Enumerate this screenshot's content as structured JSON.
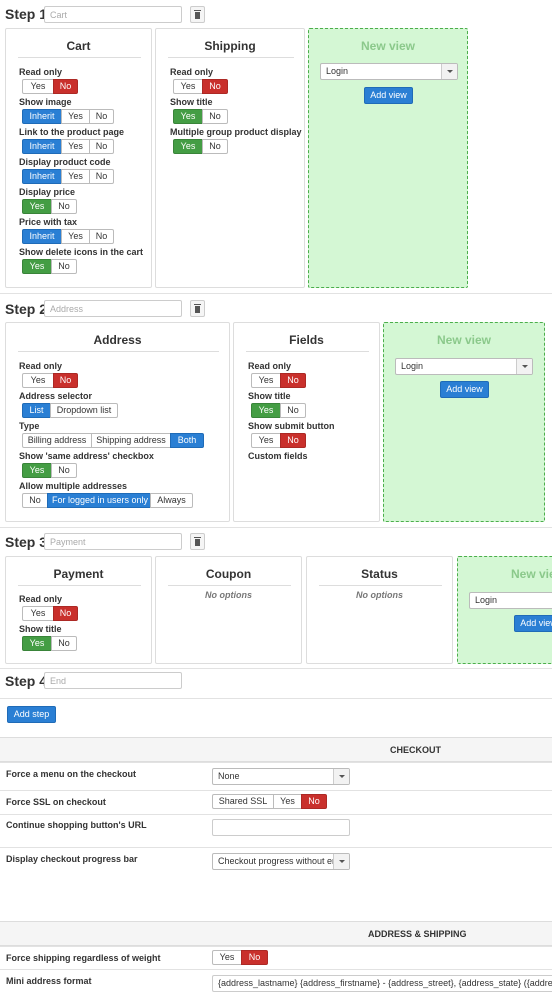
{
  "steps": [
    {
      "label": "Step 1",
      "placeholder": "Cart"
    },
    {
      "label": "Step 2",
      "placeholder": "Address"
    },
    {
      "label": "Step 3",
      "placeholder": "Payment"
    },
    {
      "label": "Step 4",
      "placeholder": "End"
    }
  ],
  "common": {
    "yes": "Yes",
    "no": "No",
    "inherit": "Inherit",
    "new_view": "New view",
    "login": "Login",
    "add_view": "Add view",
    "no_options": "No options"
  },
  "cart": {
    "title": "Cart",
    "read_only": "Read only",
    "show_image": "Show image",
    "link_product": "Link to the product page",
    "display_code": "Display product code",
    "display_price": "Display price",
    "price_tax": "Price with tax",
    "show_delete": "Show delete icons in the cart"
  },
  "shipping": {
    "title": "Shipping",
    "read_only": "Read only",
    "show_title": "Show title",
    "multi_group": "Multiple group product display"
  },
  "address": {
    "title": "Address",
    "read_only": "Read only",
    "selector": "Address selector",
    "list": "List",
    "dropdown": "Dropdown list",
    "type": "Type",
    "billing": "Billing address",
    "shipping_addr": "Shipping address",
    "both": "Both",
    "same_address": "Show 'same address' checkbox",
    "multiple": "Allow multiple addresses",
    "logged_only": "For logged in users only",
    "always": "Always"
  },
  "fields": {
    "title": "Fields",
    "read_only": "Read only",
    "show_title": "Show title",
    "show_submit": "Show submit button",
    "custom_fields": "Custom fields"
  },
  "payment": {
    "title": "Payment",
    "read_only": "Read only",
    "show_title": "Show title"
  },
  "coupon": {
    "title": "Coupon"
  },
  "status": {
    "title": "Status"
  },
  "add_step": "Add step",
  "checkout": {
    "header": "CHECKOUT",
    "force_menu": "Force a menu on the checkout",
    "force_menu_value": "None",
    "force_ssl": "Force SSL on checkout",
    "shared_ssl": "Shared SSL",
    "continue_url": "Continue shopping button's URL",
    "continue_url_value": "",
    "progress_bar": "Display checkout progress bar",
    "progress_bar_value": "Checkout progress without end"
  },
  "address_shipping": {
    "header": "ADDRESS & SHIPPING",
    "force_shipping": "Force shipping regardless of weight",
    "mini_format": "Mini address format",
    "mini_format_value": "{address_lastname} {address_firstname} - {address_street}, {address_state} ({address_country})"
  }
}
